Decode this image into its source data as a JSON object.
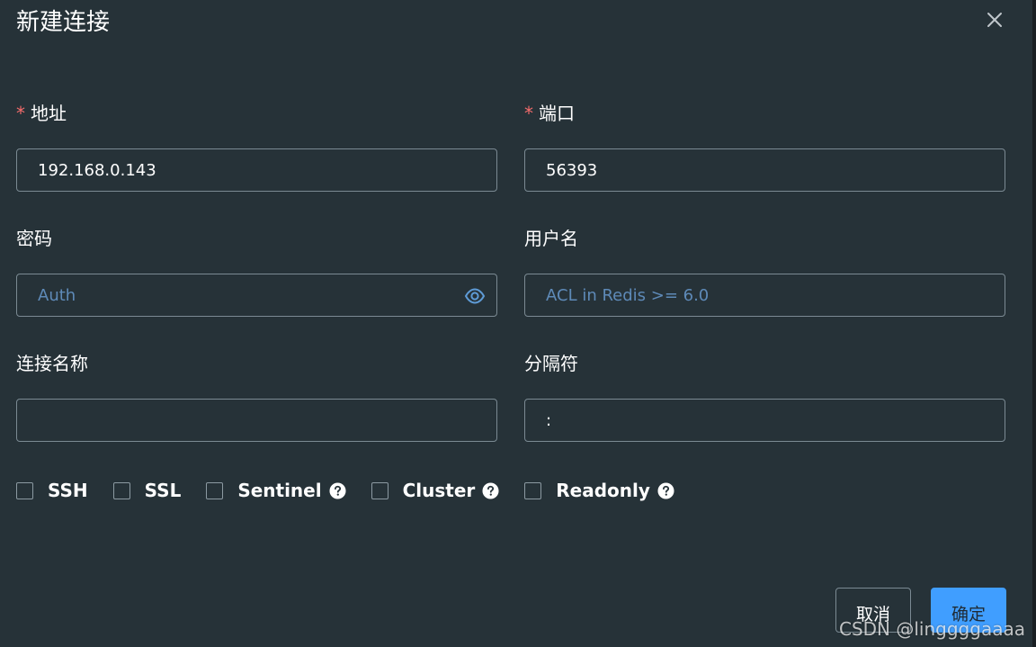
{
  "dialog": {
    "title": "新建连接"
  },
  "fields": {
    "address": {
      "required_mark": "*",
      "label": "地址",
      "value": "192.168.0.143"
    },
    "port": {
      "required_mark": "*",
      "label": "端口",
      "value": "56393"
    },
    "password": {
      "label": "密码",
      "placeholder": "Auth"
    },
    "username": {
      "label": "用户名",
      "placeholder": "ACL in Redis >= 6.0"
    },
    "connection_name": {
      "label": "连接名称",
      "value": ""
    },
    "separator": {
      "label": "分隔符",
      "value": ":"
    }
  },
  "options": [
    {
      "label": "SSH",
      "checked": false,
      "help": false
    },
    {
      "label": "SSL",
      "checked": false,
      "help": false
    },
    {
      "label": "Sentinel",
      "checked": false,
      "help": true
    },
    {
      "label": "Cluster",
      "checked": false,
      "help": true
    },
    {
      "label": "Readonly",
      "checked": false,
      "help": true
    }
  ],
  "buttons": {
    "cancel": "取消",
    "confirm": "确定"
  },
  "watermark": "CSDN @linggggaaaa",
  "colors": {
    "background": "#263238",
    "required": "#f56c6c",
    "primary": "#409eff",
    "placeholder": "#5e8ab8"
  },
  "icons": {
    "close": "close-icon",
    "password_toggle": "eye-icon",
    "help": "question-circle-icon"
  }
}
